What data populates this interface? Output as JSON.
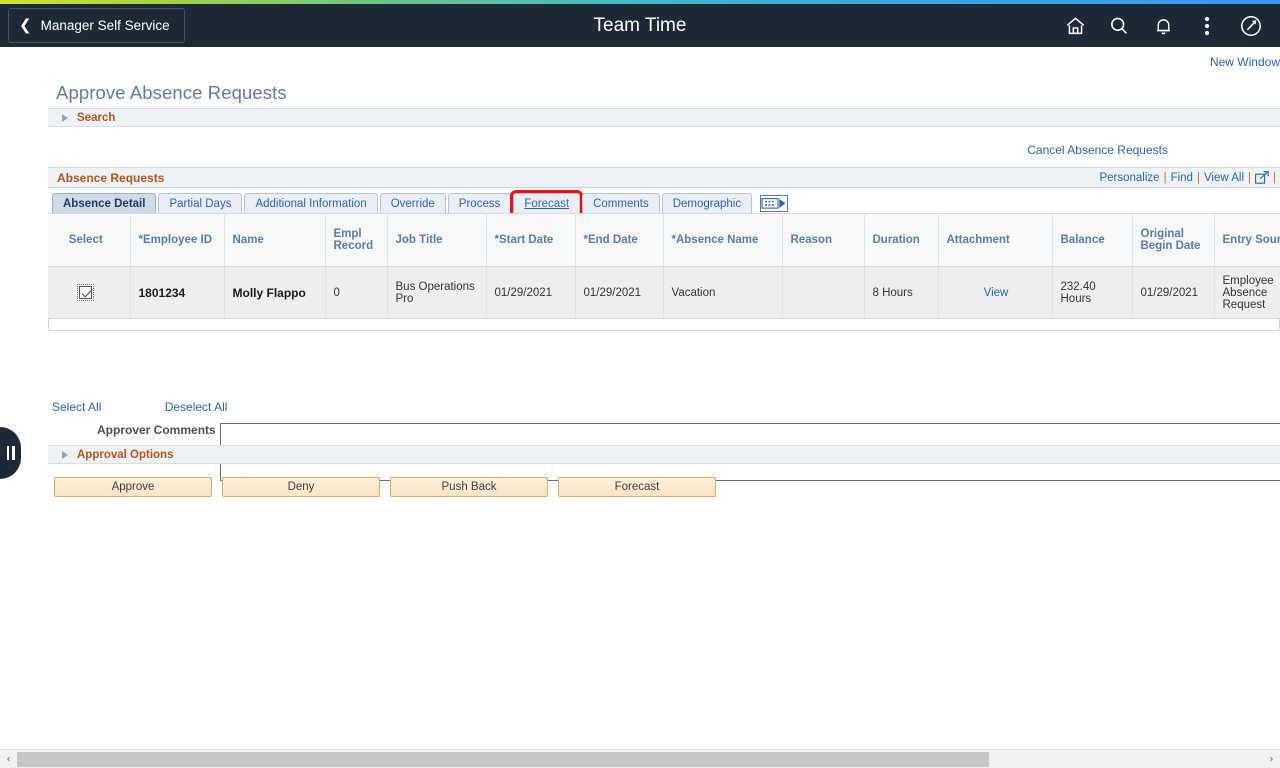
{
  "header": {
    "back_label": "Manager Self Service",
    "title": "Team Time",
    "icons": [
      {
        "name": "home-icon",
        "label": "Home"
      },
      {
        "name": "search-icon",
        "label": "Search"
      },
      {
        "name": "notifications-bell-icon",
        "label": "Notifications"
      },
      {
        "name": "actions-kebab-icon",
        "label": "Actions"
      },
      {
        "name": "navigator-compass-icon",
        "label": "NavBar"
      }
    ],
    "background_color": "#1e2936",
    "gradient_from": "#d4e52a",
    "gradient_to": "#3f95f3"
  },
  "page": {
    "new_window_link": "New Window",
    "title": "Approve Absence Requests",
    "search_section_label": "Search",
    "cancel_absence_link": "Cancel Absence Requests",
    "approval_options_label": "Approval Options"
  },
  "grid": {
    "title": "Absence Requests",
    "actions": {
      "personalize": "Personalize",
      "find": "Find",
      "view_all": "View All",
      "separator": "|",
      "expand_icon": "expand-grid-icon"
    },
    "tabs": [
      {
        "label": "Absence Detail",
        "active": true,
        "highlighted": false,
        "hovered": false
      },
      {
        "label": "Partial Days",
        "active": false,
        "highlighted": false,
        "hovered": false
      },
      {
        "label": "Additional Information",
        "active": false,
        "highlighted": false,
        "hovered": false
      },
      {
        "label": "Override",
        "active": false,
        "highlighted": false,
        "hovered": false
      },
      {
        "label": "Process",
        "active": false,
        "highlighted": false,
        "hovered": false
      },
      {
        "label": "Forecast",
        "active": false,
        "highlighted": true,
        "hovered": true
      },
      {
        "label": "Comments",
        "active": false,
        "highlighted": false,
        "hovered": false
      },
      {
        "label": "Demographic",
        "active": false,
        "highlighted": false,
        "hovered": false
      }
    ],
    "columns": [
      "Select",
      "*Employee ID",
      "Name",
      "Empl Record",
      "Job Title",
      "*Start Date",
      "*End Date",
      "*Absence Name",
      "Reason",
      "Duration",
      "Attachment",
      "Balance",
      "Original Begin Date",
      "Entry Source"
    ],
    "rows": [
      {
        "selected": true,
        "employee_id": "1801234",
        "name": "Molly Flappo",
        "empl_record": "0",
        "job_title": "Bus Operations Pro",
        "start_date": "01/29/2021",
        "end_date": "01/29/2021",
        "absence_name": "Vacation",
        "reason": "",
        "duration": "8 Hours",
        "attachment": "View",
        "balance": "232.40 Hours",
        "original_begin_date": "01/29/2021",
        "entry_source": "Employee Absence Request"
      }
    ]
  },
  "selection": {
    "select_all": "Select All",
    "deselect_all": "Deselect All"
  },
  "comments": {
    "label": "Approver Comments",
    "value": "",
    "placeholder": ""
  },
  "buttons": [
    {
      "label": "Approve",
      "name": "approve-button"
    },
    {
      "label": "Deny",
      "name": "deny-button"
    },
    {
      "label": "Push Back",
      "name": "push-back-button"
    },
    {
      "label": "Forecast",
      "name": "forecast-button"
    }
  ],
  "scrollbar": {
    "left_arrow": "‹",
    "right_arrow": "›",
    "thumb_percent": 78
  },
  "colors": {
    "accent_link": "#2a62b4",
    "section_heading": "#b0561a",
    "header_text": "#5b7ba6",
    "highlight_box": "#ee1111",
    "button_face": "#fae4c4"
  }
}
